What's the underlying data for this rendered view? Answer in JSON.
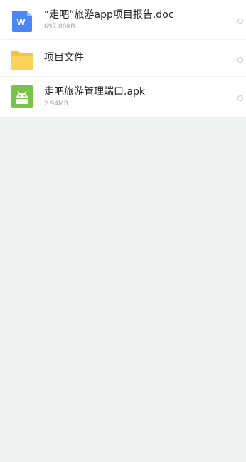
{
  "files": [
    {
      "name": "“走吧”旅游app项目报告.doc",
      "meta": "697.00KB",
      "icon": "word-document-icon",
      "icon_color": "#4a86f7"
    },
    {
      "name": "项目文件",
      "meta": "",
      "icon": "folder-icon",
      "icon_color": "#f6c443"
    },
    {
      "name": "走吧旅游管理端口.apk",
      "meta": "2.94MB",
      "icon": "android-apk-icon",
      "icon_color": "#79c34a"
    }
  ]
}
